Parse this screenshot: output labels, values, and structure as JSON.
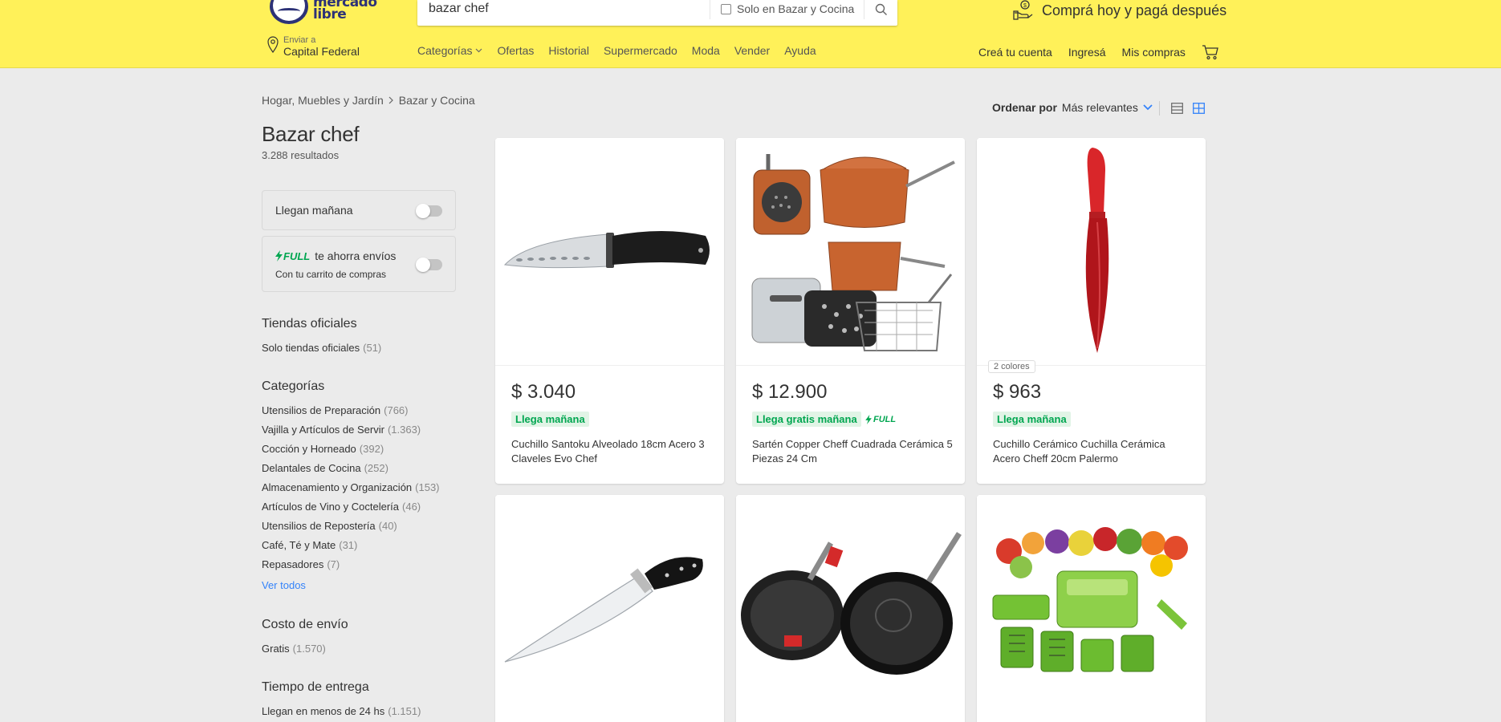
{
  "header": {
    "logo_line1": "mercado",
    "logo_line2": "libre",
    "search_value": "bazar chef",
    "search_scope_label": "Solo en Bazar y Cocina",
    "promo_text": "Comprá hoy y pagá después",
    "ship_to_label": "Enviar a",
    "ship_to_location": "Capital Federal",
    "nav": [
      {
        "label": "Categorías"
      },
      {
        "label": "Ofertas"
      },
      {
        "label": "Historial"
      },
      {
        "label": "Supermercado"
      },
      {
        "label": "Moda"
      },
      {
        "label": "Vender"
      },
      {
        "label": "Ayuda"
      }
    ],
    "account": {
      "create": "Creá tu cuenta",
      "login": "Ingresá",
      "purchases": "Mis compras"
    }
  },
  "breadcrumb": [
    "Hogar, Muebles y Jardín",
    "Bazar y Cocina"
  ],
  "page_title": "Bazar chef",
  "results_count": "3.288 resultados",
  "sort": {
    "label": "Ordenar por",
    "value": "Más relevantes"
  },
  "filters": {
    "arrives_tomorrow": "Llegan mañana",
    "full_logo": "FULL",
    "full_text": "te ahorra envíos",
    "full_sub": "Con tu carrito de compras",
    "official_title": "Tiendas oficiales",
    "official_item": {
      "label": "Solo tiendas oficiales",
      "count": "(51)"
    },
    "categories_title": "Categorías",
    "categories": [
      {
        "label": "Utensilios de Preparación",
        "count": "(766)"
      },
      {
        "label": "Vajilla y Artículos de Servir",
        "count": "(1.363)"
      },
      {
        "label": "Cocción y Horneado",
        "count": "(392)"
      },
      {
        "label": "Delantales de Cocina",
        "count": "(252)"
      },
      {
        "label": "Almacenamiento y Organización",
        "count": "(153)"
      },
      {
        "label": "Artículos de Vino y Coctelería",
        "count": "(46)"
      },
      {
        "label": "Utensilios de Repostería",
        "count": "(40)"
      },
      {
        "label": "Café, Té y Mate",
        "count": "(31)"
      },
      {
        "label": "Repasadores",
        "count": "(7)"
      }
    ],
    "see_all": "Ver todos",
    "shipping_title": "Costo de envío",
    "shipping_item": {
      "label": "Gratis",
      "count": "(1.570)"
    },
    "delivery_title": "Tiempo de entrega",
    "delivery_item": {
      "label": "Llegan en menos de 24 hs",
      "count": "(1.151)"
    }
  },
  "products": [
    {
      "price": "$ 3.040",
      "tag": "Llega mañana",
      "title": "Cuchillo Santoku Alveolado 18cm Acero 3 Claveles Evo Chef",
      "image": "santoku-knife-image"
    },
    {
      "price": "$ 12.900",
      "tag": "Llega gratis mañana",
      "full": "FULL",
      "title": "Sartén Copper Cheff Cuadrada Cerámica 5 Piezas 24 Cm",
      "image": "copper-pan-set-image"
    },
    {
      "price": "$ 963",
      "tag": "Llega mañana",
      "colors": "2 colores",
      "title": "Cuchillo Cerámico Cuchilla Cerámica Acero Cheff 20cm Palermo",
      "image": "red-ceramic-knife-image"
    },
    {
      "image": "chef-knife-image"
    },
    {
      "image": "frying-pans-image"
    },
    {
      "image": "vegetable-chopper-image"
    }
  ],
  "colors": {
    "header_bg": "#fff159",
    "brand_navy": "#2d3277",
    "link_blue": "#3483fa",
    "shipping_green": "#00a650",
    "page_bg": "#ebebeb"
  }
}
